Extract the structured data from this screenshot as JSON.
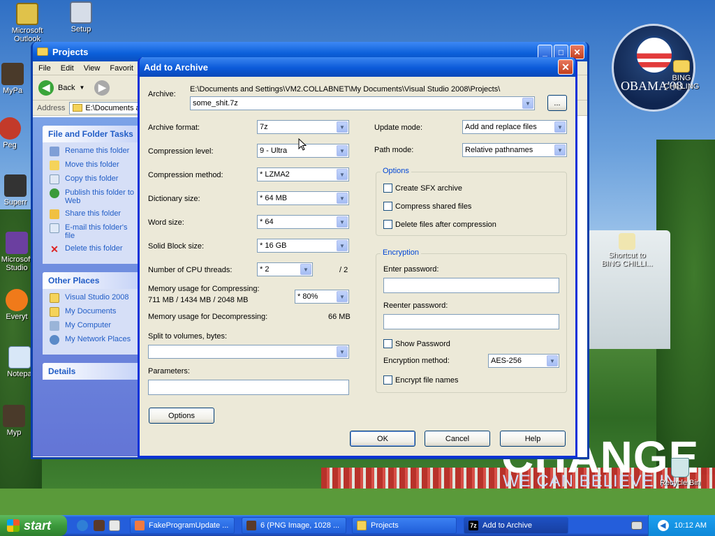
{
  "desktop": {
    "icons": [
      {
        "label": "Microsoft Outlook",
        "top": "Microsoft",
        "bottom": "Outlook"
      },
      {
        "label": "Setup"
      },
      {
        "label": "MyPa"
      },
      {
        "label": "Peg"
      },
      {
        "label": "Superr"
      },
      {
        "label": "Microsoft Studio",
        "top": "Microsoft",
        "bottom": "Studio"
      },
      {
        "label": "Everyt"
      },
      {
        "label": "Notepa"
      },
      {
        "label": "Myp"
      },
      {
        "label": "BING CHILLING"
      },
      {
        "label": "Shortcut to BING CHILLI...",
        "top": "Shortcut to",
        "bottom": "BING CHILLI..."
      },
      {
        "label": "Recycle Bin"
      }
    ],
    "wallpaper_text": {
      "change": "CHANGE",
      "believe": "WE CAN BELIEVE IN",
      "logo": "OBAMA'08"
    }
  },
  "explorer": {
    "title": "Projects",
    "menu": [
      "File",
      "Edit",
      "View",
      "Favorit"
    ],
    "back_label": "Back",
    "address_label": "Address",
    "address_value": "E:\\Documents an",
    "file_tasks": {
      "heading": "File and Folder Tasks",
      "items": [
        "Rename this folder",
        "Move this folder",
        "Copy this folder",
        "Publish this folder to Web",
        "Share this folder",
        "E-mail this folder's file",
        "Delete this folder"
      ]
    },
    "other_places": {
      "heading": "Other Places",
      "items": [
        "Visual Studio 2008",
        "My Documents",
        "My Computer",
        "My Network Places"
      ]
    },
    "details_heading": "Details"
  },
  "dialog": {
    "title": "Add to Archive",
    "archive_label": "Archive:",
    "archive_path": "E:\\Documents and Settings\\VM2.COLLABNET\\My Documents\\Visual Studio 2008\\Projects\\",
    "archive_name": "some_shit.7z",
    "browse_label": "...",
    "left": {
      "archive_format": {
        "label": "Archive format:",
        "value": "7z"
      },
      "compression_level": {
        "label": "Compression level:",
        "value": "9 - Ultra"
      },
      "compression_method": {
        "label": "Compression method:",
        "value": "* LZMA2"
      },
      "dictionary_size": {
        "label": "Dictionary size:",
        "value": "* 64 MB"
      },
      "word_size": {
        "label": "Word size:",
        "value": "* 64"
      },
      "solid_block": {
        "label": "Solid Block size:",
        "value": "* 16 GB"
      },
      "cpu_threads": {
        "label": "Number of CPU threads:",
        "value": "* 2",
        "max": "/ 2"
      },
      "mem_compress": {
        "label": "Memory usage for Compressing:",
        "detail": "711 MB / 1434 MB / 2048 MB",
        "value": "* 80%"
      },
      "mem_decompress": {
        "label": "Memory usage for Decompressing:",
        "value": "66 MB"
      },
      "split_label": "Split to volumes, bytes:",
      "params_label": "Parameters:",
      "options_button": "Options"
    },
    "right": {
      "update_mode": {
        "label": "Update mode:",
        "value": "Add and replace files"
      },
      "path_mode": {
        "label": "Path mode:",
        "value": "Relative pathnames"
      },
      "options_group": {
        "title": "Options",
        "items": [
          "Create SFX archive",
          "Compress shared files",
          "Delete files after compression"
        ]
      },
      "encryption_group": {
        "title": "Encryption",
        "enter_password": "Enter password:",
        "reenter_password": "Reenter password:",
        "show_password": "Show Password",
        "method_label": "Encryption method:",
        "method_value": "AES-256",
        "encrypt_names": "Encrypt file names"
      }
    },
    "buttons": {
      "ok": "OK",
      "cancel": "Cancel",
      "help": "Help"
    }
  },
  "taskbar": {
    "start": "start",
    "items": [
      "FakeProgramUpdate ...",
      "6 (PNG Image, 1028 ...",
      "Projects",
      "Add to Archive"
    ],
    "clock": "10:12 AM"
  }
}
